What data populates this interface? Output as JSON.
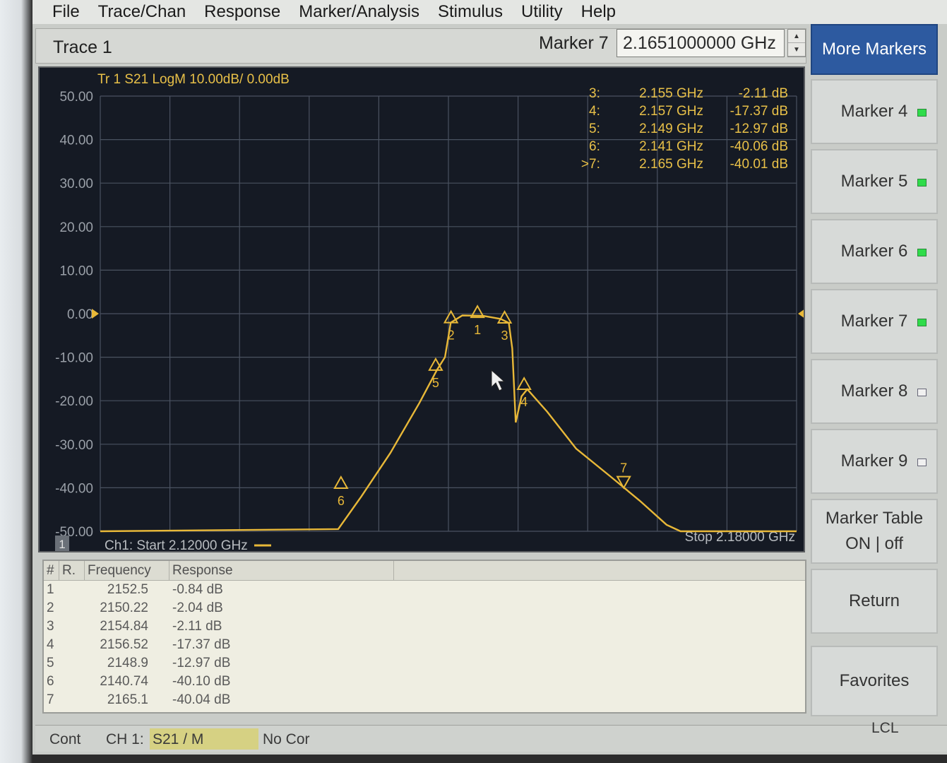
{
  "menu": [
    "File",
    "Trace/Chan",
    "Response",
    "Marker/Analysis",
    "Stimulus",
    "Utility",
    "Help"
  ],
  "entry": {
    "trace_label": "Trace 1",
    "marker_label": "Marker 7",
    "marker_value": "2.1651000000 GHz"
  },
  "plot": {
    "trace_header": "Tr 1  S21 LogM 10.00dB/ 0.00dB",
    "start_label": "Ch1: Start  2.12000 GHz",
    "stop_label": "Stop  2.18000 GHz",
    "channel_badge": "1",
    "y_ticks": [
      "50.00",
      "40.00",
      "30.00",
      "20.00",
      "10.00",
      "0.00",
      "-10.00",
      "-20.00",
      "-30.00",
      "-40.00",
      "-50.00"
    ],
    "trace_color": "#e8b838",
    "grid_color": "#4a5260",
    "marker_readout": [
      {
        "active": "",
        "id": "3:",
        "freq": "2.155 GHz",
        "value": "-2.11 dB"
      },
      {
        "active": "",
        "id": "4:",
        "freq": "2.157 GHz",
        "value": "-17.37 dB"
      },
      {
        "active": "",
        "id": "5:",
        "freq": "2.149 GHz",
        "value": "-12.97 dB"
      },
      {
        "active": "",
        "id": "6:",
        "freq": "2.141 GHz",
        "value": "-40.06 dB"
      },
      {
        "active": ">",
        "id": "7:",
        "freq": "2.165 GHz",
        "value": "-40.01 dB"
      }
    ],
    "chart_data": {
      "type": "line",
      "xlim": [
        2.12,
        2.18
      ],
      "ylim": [
        -50,
        50
      ],
      "x": [
        2.12,
        2.1405,
        2.1425,
        2.145,
        2.1475,
        2.149,
        2.1497,
        2.1502,
        2.1512,
        2.153,
        2.1545,
        2.1552,
        2.1555,
        2.1558,
        2.1563,
        2.1568,
        2.1585,
        2.161,
        2.164,
        2.1665,
        2.1688,
        2.17,
        2.18
      ],
      "y": [
        -50.0,
        -49.5,
        -42.0,
        -32.0,
        -20.5,
        -12.97,
        -10.0,
        -2.04,
        -0.4,
        -0.5,
        -1.2,
        -2.11,
        -8.0,
        -25.0,
        -19.0,
        -17.37,
        -22.5,
        -31.0,
        -37.5,
        -43.0,
        -48.5,
        -50.0,
        -50.0
      ],
      "markers": [
        {
          "label": "1",
          "x": 2.1525,
          "y": -0.84,
          "dir": "up"
        },
        {
          "label": "2",
          "x": 2.15022,
          "y": -2.04,
          "dir": "up"
        },
        {
          "label": "3",
          "x": 2.15484,
          "y": -2.11,
          "dir": "up"
        },
        {
          "label": "4",
          "x": 2.15652,
          "y": -17.37,
          "dir": "up"
        },
        {
          "label": "5",
          "x": 2.1489,
          "y": -12.97,
          "dir": "up"
        },
        {
          "label": "6",
          "x": 2.14074,
          "y": -40.1,
          "dir": "up"
        },
        {
          "label": "7",
          "x": 2.1651,
          "y": -40.04,
          "dir": "down"
        }
      ]
    }
  },
  "table": {
    "headers": [
      "#",
      "R.",
      "Frequency",
      "Response"
    ],
    "rows": [
      {
        "n": "1",
        "freq": "2152.5",
        "resp": "-0.84 dB"
      },
      {
        "n": "2",
        "freq": "2150.22",
        "resp": "-2.04 dB"
      },
      {
        "n": "3",
        "freq": "2154.84",
        "resp": "-2.11 dB"
      },
      {
        "n": "4",
        "freq": "2156.52",
        "resp": "-17.37 dB"
      },
      {
        "n": "5",
        "freq": "2148.9",
        "resp": "-12.97 dB"
      },
      {
        "n": "6",
        "freq": "2140.74",
        "resp": "-40.10 dB"
      },
      {
        "n": "7",
        "freq": "2165.1",
        "resp": "-40.04 dB"
      }
    ]
  },
  "softkeys": [
    {
      "label": "More Markers",
      "active": true
    },
    {
      "label": "Marker 4",
      "led": "on"
    },
    {
      "label": "Marker 5",
      "led": "on"
    },
    {
      "label": "Marker 6",
      "led": "on"
    },
    {
      "label": "Marker 7",
      "led": "on"
    },
    {
      "label": "Marker 8",
      "led": "off"
    },
    {
      "label": "Marker 9",
      "led": "off"
    },
    {
      "label": "Marker Table\nON | off"
    },
    {
      "label": "Return"
    },
    {
      "label": "Favorites"
    }
  ],
  "status": {
    "mode": "Cont",
    "channel": "CH 1:",
    "meas": "S21 / M",
    "correction": "No Cor",
    "lcl": "LCL"
  }
}
